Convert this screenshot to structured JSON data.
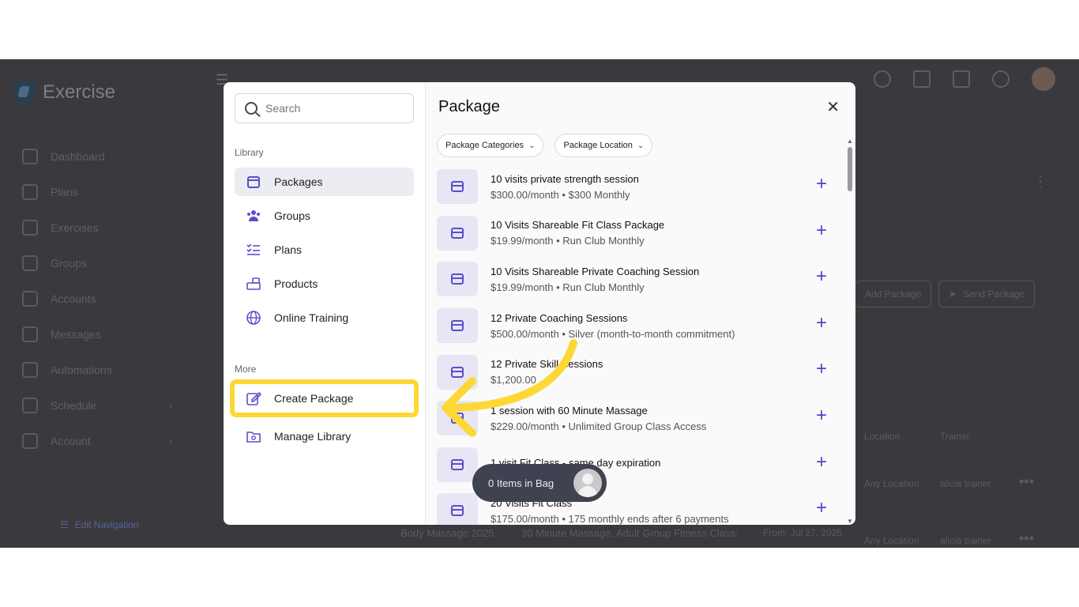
{
  "app": {
    "name": "Exercise",
    "nav": [
      {
        "label": "Dashboard",
        "icon": "home-icon"
      },
      {
        "label": "Plans",
        "icon": "clipboard-icon"
      },
      {
        "label": "Exercises",
        "icon": "dumbbell-icon"
      },
      {
        "label": "Groups",
        "icon": "users-icon"
      },
      {
        "label": "Accounts",
        "icon": "user-icon"
      },
      {
        "label": "Messages",
        "icon": "mail-icon"
      },
      {
        "label": "Automations",
        "icon": "robot-icon"
      },
      {
        "label": "Schedule",
        "icon": "calendar-icon"
      },
      {
        "label": "Account",
        "icon": "user-gear-icon"
      }
    ],
    "edit_navigation": "Edit Navigation",
    "add_package": "Add Package",
    "send_package": "Send Package",
    "col_location": "Location",
    "col_trainer": "Trainer",
    "row1_location": "Any Location",
    "row1_trainer": "alicia trainer",
    "row2_location": "Any Location",
    "row2_trainer": "alicia trainer",
    "row2_name": "Body Massage 2025",
    "row2_desc": "30 Minute Massage, Adult Group Fitness Class:",
    "row2_date": "From: Jul 27, 2025"
  },
  "modal": {
    "search_placeholder": "Search",
    "library_label": "Library",
    "library_items": [
      {
        "label": "Packages",
        "icon": "package-icon",
        "active": true
      },
      {
        "label": "Groups",
        "icon": "users-icon"
      },
      {
        "label": "Plans",
        "icon": "checklist-icon"
      },
      {
        "label": "Products",
        "icon": "products-icon"
      },
      {
        "label": "Online Training",
        "icon": "globe-icon"
      }
    ],
    "more_label": "More",
    "create_package": "Create Package",
    "manage_library": "Manage Library",
    "title": "Package",
    "filter_categories": "Package Categories",
    "filter_location": "Package Location",
    "packages": [
      {
        "name": "10 visits private strength session",
        "sub": "$300.00/month • $300 Monthly"
      },
      {
        "name": "10 Visits Shareable Fit Class Package",
        "sub": "$19.99/month • Run Club Monthly"
      },
      {
        "name": "10 Visits Shareable Private Coaching Session",
        "sub": "$19.99/month • Run Club Monthly"
      },
      {
        "name": "12 Private Coaching Sessions",
        "sub": "$500.00/month • Silver (month-to-month commitment)"
      },
      {
        "name": "12 Private Skill Sessions",
        "sub": "$1,200.00"
      },
      {
        "name": "1 session with 60 Minute Massage",
        "sub": "$229.00/month • Unlimited Group Class Access"
      },
      {
        "name": "1 visit Fit Class - same day expiration",
        "sub": ""
      },
      {
        "name": "20 Visits Fit Class",
        "sub": "$175.00/month • 175 monthly ends after 6 payments"
      }
    ],
    "bag_text": "0 Items in Bag"
  },
  "colors": {
    "accent": "#4f45c7",
    "highlight": "#fdd835",
    "overlay": "#3a3a3e"
  }
}
